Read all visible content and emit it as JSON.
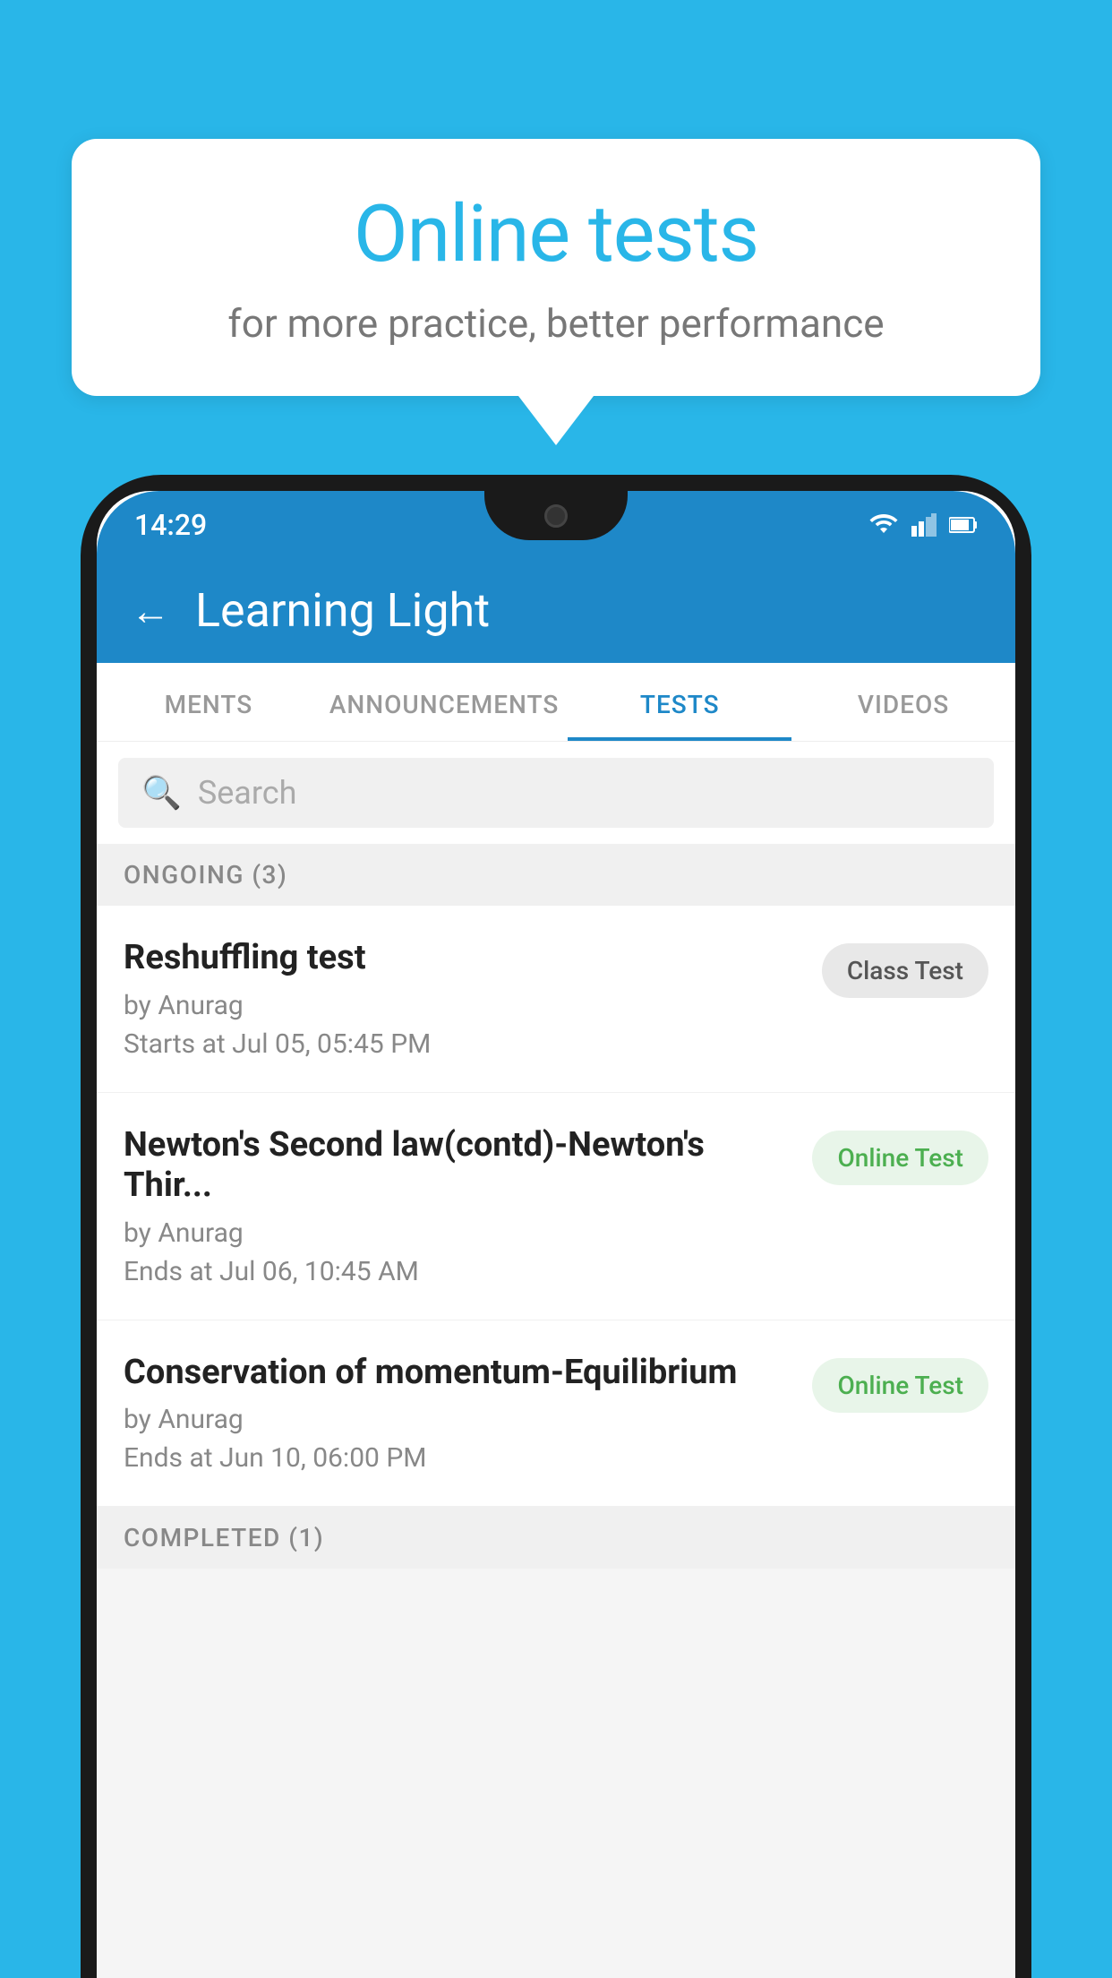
{
  "background_color": "#29B6E8",
  "speech_bubble": {
    "title": "Online tests",
    "subtitle": "for more practice, better performance"
  },
  "phone": {
    "status_bar": {
      "time": "14:29"
    },
    "app_header": {
      "title": "Learning Light",
      "back_label": "←"
    },
    "tabs": [
      {
        "label": "MENTS",
        "active": false
      },
      {
        "label": "ANNOUNCEMENTS",
        "active": false
      },
      {
        "label": "TESTS",
        "active": true
      },
      {
        "label": "VIDEOS",
        "active": false
      }
    ],
    "search": {
      "placeholder": "Search"
    },
    "section": {
      "label": "ONGOING (3)"
    },
    "tests": [
      {
        "name": "Reshuffling test",
        "by": "by Anurag",
        "date": "Starts at  Jul 05, 05:45 PM",
        "badge": "Class Test",
        "badge_type": "class"
      },
      {
        "name": "Newton's Second law(contd)-Newton's Thir...",
        "by": "by Anurag",
        "date": "Ends at  Jul 06, 10:45 AM",
        "badge": "Online Test",
        "badge_type": "online"
      },
      {
        "name": "Conservation of momentum-Equilibrium",
        "by": "by Anurag",
        "date": "Ends at  Jun 10, 06:00 PM",
        "badge": "Online Test",
        "badge_type": "online"
      }
    ],
    "completed_label": "COMPLETED (1)"
  }
}
